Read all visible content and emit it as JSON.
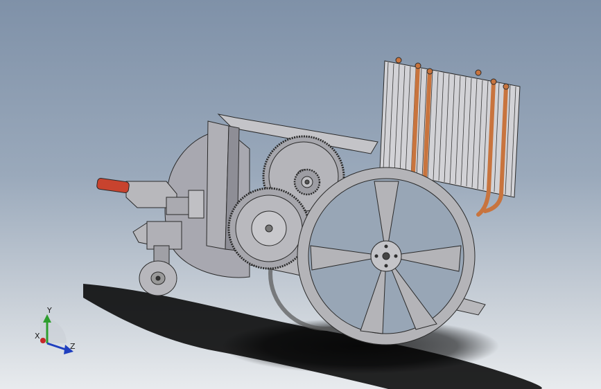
{
  "viewport": {
    "background_top": "#7f91a8",
    "background_bottom": "#e8ebee",
    "model_fill": "#b4b4b8",
    "model_stroke": "#2a2a2a",
    "heat_pipe_color": "#c8743e",
    "handle_color": "#c8432e"
  },
  "triad": {
    "x_label": "X",
    "y_label": "Y",
    "z_label": "Z",
    "x_color": "#c62828",
    "y_color": "#2e9e2e",
    "z_color": "#1f3fbf"
  }
}
